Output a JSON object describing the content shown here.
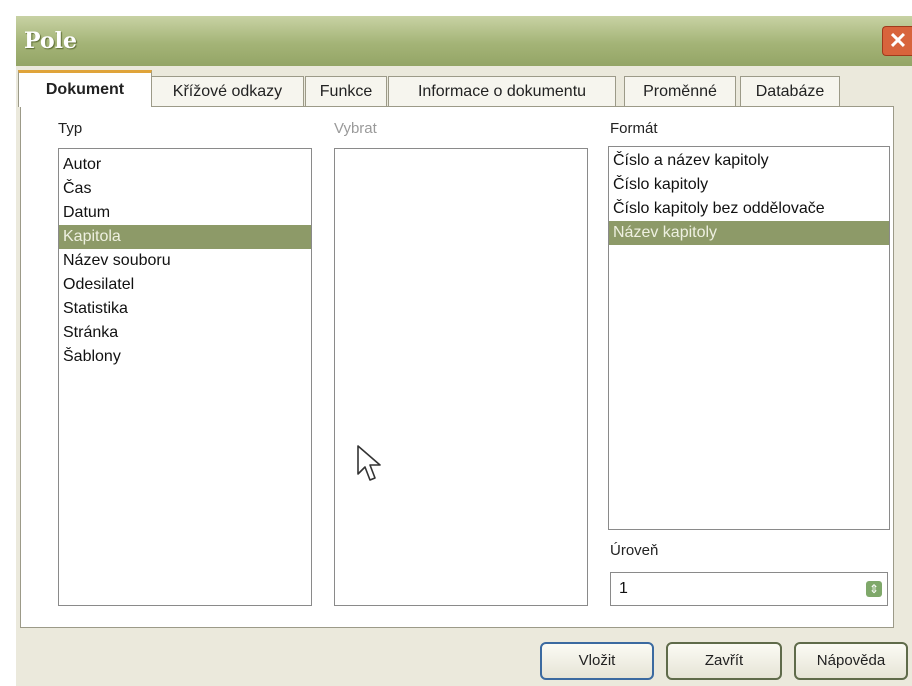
{
  "window": {
    "title": "Pole",
    "close": "✕"
  },
  "tabs": [
    {
      "label": "Dokument"
    },
    {
      "label": "Křížové odkazy"
    },
    {
      "label": "Funkce"
    },
    {
      "label": "Informace o dokumentu"
    },
    {
      "label": "Proměnné"
    },
    {
      "label": "Databáze"
    }
  ],
  "type_list": {
    "label": "Typ",
    "items": [
      "Autor",
      "Čas",
      "Datum",
      "Kapitola",
      "Název souboru",
      "Odesilatel",
      "Statistika",
      "Stránka",
      "Šablony"
    ],
    "selected": "Kapitola"
  },
  "select_list": {
    "label": "Vybrat"
  },
  "format_list": {
    "label": "Formát",
    "items": [
      "Číslo a název kapitoly",
      "Číslo kapitoly",
      "Číslo kapitoly bez oddělovače",
      "Název kapitoly"
    ],
    "selected": "Název kapitoly"
  },
  "level": {
    "label": "Úroveň",
    "value": "1"
  },
  "buttons": {
    "insert": "Vložit",
    "close": "Zavřít",
    "help": "Nápověda"
  },
  "colors": {
    "titlebar": "#a4b477",
    "selection": "#8d9a68",
    "active_tab_accent": "#e0a43a"
  }
}
